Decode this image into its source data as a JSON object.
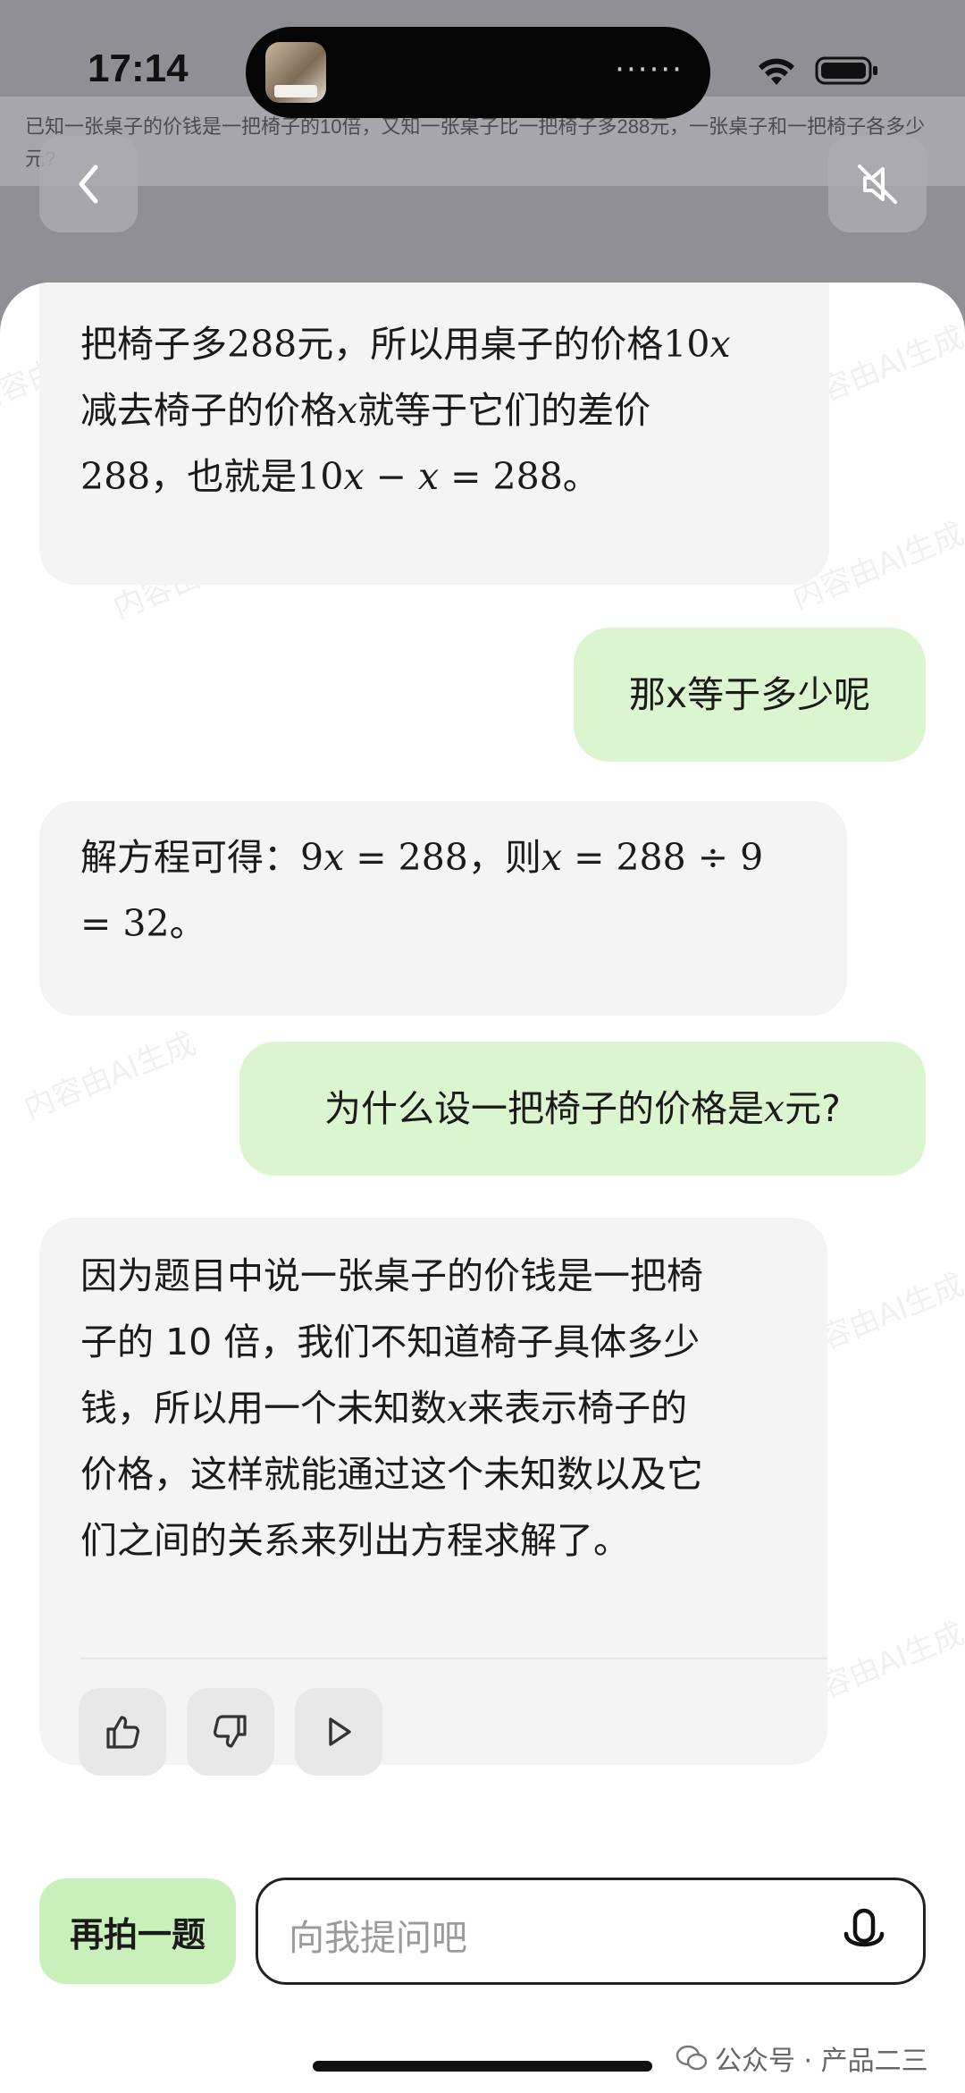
{
  "status_bar": {
    "time": "17:14",
    "island_dots": "······"
  },
  "question": {
    "text": "已知一张桌子的价钱是一把椅子的10倍，又知一张桌子比一把椅子多288元，一张桌子和一把椅子各多少元?"
  },
  "icons": {
    "back": "chevron-left-icon",
    "mute": "speaker-muted-icon",
    "sheet_handle": "chevron-down-icon",
    "like": "thumbs-up-icon",
    "dislike": "thumbs-down-icon",
    "play": "play-icon",
    "mic": "microphone-icon"
  },
  "colors": {
    "ai_bubble": "#f4f4f4",
    "user_bubble": "#dbf5d0",
    "retake_button": "#c9f0bb"
  },
  "messages": {
    "m1": {
      "l1_a": "把椅子多",
      "l1_b": "288",
      "l1_c": "元，所以用桌子的价格",
      "l1_d": "10",
      "l1_e": "x",
      "l2_a": "减去椅子的价格",
      "l2_b": "x",
      "l2_c": "就等于它们的差价",
      "l3_a": "288",
      "l3_b": "，也就是",
      "l3_c": "10",
      "l3_d": "x",
      "l3_e": " − ",
      "l3_f": "x",
      "l3_g": " = 288",
      "l3_h": "。"
    },
    "m2": {
      "text": "那x等于多少呢"
    },
    "m3": {
      "l1_a": "解方程可得：",
      "l1_b": "9",
      "l1_c": "x",
      "l1_d": " = 288",
      "l1_e": "，则",
      "l1_f": "x",
      "l1_g": " = 288 ÷ 9",
      "l2_a": "= 32",
      "l2_b": "。"
    },
    "m4": {
      "a": "为什么设一把椅子的价格是",
      "b": "x",
      "c": "元?"
    },
    "m5": {
      "l1": "因为题目中说一张桌子的价钱是一把椅",
      "l2": "子的 10 倍，我们不知道椅子具体多少",
      "l3_a": "钱，所以用一个未知数",
      "l3_b": "x",
      "l3_c": "来表示椅子的",
      "l4": "价格，这样就能通过这个未知数以及它",
      "l5": "们之间的关系来列出方程求解了。"
    }
  },
  "bottom": {
    "retake_label": "再拍一题",
    "input_placeholder": "向我提问吧"
  },
  "footer": {
    "credit": "公众号 · 产品二三"
  },
  "watermark": {
    "text": "内容由AI生成"
  }
}
